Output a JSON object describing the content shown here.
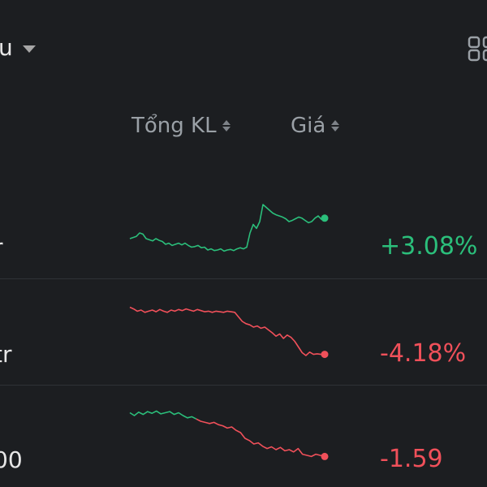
{
  "header": {
    "filter_label": "u",
    "columns": {
      "volume": "Tổng KL",
      "price": "Giá"
    }
  },
  "colors": {
    "up": "#2bbf7b",
    "down": "#f0505a",
    "muted": "#9aa0a6",
    "background": "#1c1e21"
  },
  "icons": {
    "filter_caret": "caret-down-icon",
    "layout": "grid-layout-icon",
    "sort": "sort-updown-icon"
  },
  "rows": [
    {
      "left_text": "r",
      "change": "+3.08%",
      "trend": "up",
      "spark": {
        "segments": [
          {
            "color": "up",
            "values": [
              0.3,
              0.32,
              0.34,
              0.4,
              0.38,
              0.3,
              0.28,
              0.26,
              0.3,
              0.27,
              0.25,
              0.2,
              0.22,
              0.18,
              0.2,
              0.22,
              0.19,
              0.22,
              0.18,
              0.15,
              0.16,
              0.18,
              0.14,
              0.15,
              0.1,
              0.12,
              0.09,
              0.1,
              0.12,
              0.08,
              0.1,
              0.11,
              0.09,
              0.12,
              0.14,
              0.12,
              0.15,
              0.4,
              0.55,
              0.48,
              0.6,
              0.9,
              0.85,
              0.8,
              0.75,
              0.72,
              0.7,
              0.68,
              0.65,
              0.6,
              0.62,
              0.65,
              0.68,
              0.66,
              0.62,
              0.58,
              0.6,
              0.66,
              0.7,
              0.64,
              0.66
            ]
          }
        ]
      }
    },
    {
      "left_text": "tr",
      "change": "-4.18%",
      "trend": "down",
      "spark": {
        "segments": [
          {
            "color": "down",
            "values": [
              0.95,
              0.92,
              0.88,
              0.9,
              0.86,
              0.88,
              0.9,
              0.87,
              0.91,
              0.88,
              0.86,
              0.9,
              0.88,
              0.91,
              0.89,
              0.92,
              0.9,
              0.88,
              0.91,
              0.89,
              0.87,
              0.88,
              0.86,
              0.88,
              0.87,
              0.86,
              0.88,
              0.87,
              0.86,
              0.78,
              0.7,
              0.66,
              0.64,
              0.6,
              0.62,
              0.58,
              0.6,
              0.55,
              0.5,
              0.44,
              0.48,
              0.4,
              0.46,
              0.42,
              0.35,
              0.25,
              0.15,
              0.1,
              0.16,
              0.12,
              0.13,
              0.12,
              0.12
            ]
          }
        ]
      }
    },
    {
      "left_text": "00",
      "change": "-1.59",
      "trend": "down",
      "spark": {
        "segments": [
          {
            "color": "up",
            "values": [
              0.95,
              0.9,
              0.96,
              0.92,
              0.97,
              0.94,
              0.98,
              0.93,
              0.95,
              0.97,
              0.92,
              0.95,
              0.9,
              0.86,
              0.88,
              0.84
            ]
          },
          {
            "color": "down",
            "values": [
              0.84,
              0.8,
              0.78,
              0.76,
              0.78,
              0.74,
              0.72,
              0.68,
              0.7,
              0.64,
              0.6,
              0.5,
              0.46,
              0.4,
              0.42,
              0.36,
              0.32,
              0.35,
              0.3,
              0.34,
              0.28,
              0.3,
              0.26,
              0.32,
              0.22,
              0.2,
              0.18,
              0.22,
              0.2,
              0.18
            ]
          }
        ]
      }
    }
  ]
}
